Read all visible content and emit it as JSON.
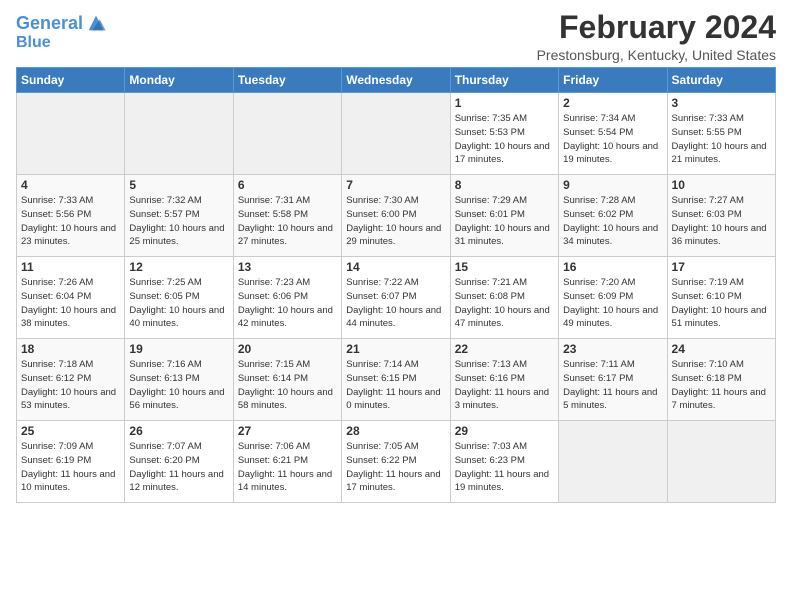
{
  "logo": {
    "line1": "General",
    "line2": "Blue"
  },
  "title": "February 2024",
  "subtitle": "Prestonsburg, Kentucky, United States",
  "days_of_week": [
    "Sunday",
    "Monday",
    "Tuesday",
    "Wednesday",
    "Thursday",
    "Friday",
    "Saturday"
  ],
  "weeks": [
    [
      {
        "num": "",
        "empty": true
      },
      {
        "num": "",
        "empty": true
      },
      {
        "num": "",
        "empty": true
      },
      {
        "num": "",
        "empty": true
      },
      {
        "num": "1",
        "sunrise": "7:35 AM",
        "sunset": "5:53 PM",
        "daylight": "10 hours and 17 minutes."
      },
      {
        "num": "2",
        "sunrise": "7:34 AM",
        "sunset": "5:54 PM",
        "daylight": "10 hours and 19 minutes."
      },
      {
        "num": "3",
        "sunrise": "7:33 AM",
        "sunset": "5:55 PM",
        "daylight": "10 hours and 21 minutes."
      }
    ],
    [
      {
        "num": "4",
        "sunrise": "7:33 AM",
        "sunset": "5:56 PM",
        "daylight": "10 hours and 23 minutes."
      },
      {
        "num": "5",
        "sunrise": "7:32 AM",
        "sunset": "5:57 PM",
        "daylight": "10 hours and 25 minutes."
      },
      {
        "num": "6",
        "sunrise": "7:31 AM",
        "sunset": "5:58 PM",
        "daylight": "10 hours and 27 minutes."
      },
      {
        "num": "7",
        "sunrise": "7:30 AM",
        "sunset": "6:00 PM",
        "daylight": "10 hours and 29 minutes."
      },
      {
        "num": "8",
        "sunrise": "7:29 AM",
        "sunset": "6:01 PM",
        "daylight": "10 hours and 31 minutes."
      },
      {
        "num": "9",
        "sunrise": "7:28 AM",
        "sunset": "6:02 PM",
        "daylight": "10 hours and 34 minutes."
      },
      {
        "num": "10",
        "sunrise": "7:27 AM",
        "sunset": "6:03 PM",
        "daylight": "10 hours and 36 minutes."
      }
    ],
    [
      {
        "num": "11",
        "sunrise": "7:26 AM",
        "sunset": "6:04 PM",
        "daylight": "10 hours and 38 minutes."
      },
      {
        "num": "12",
        "sunrise": "7:25 AM",
        "sunset": "6:05 PM",
        "daylight": "10 hours and 40 minutes."
      },
      {
        "num": "13",
        "sunrise": "7:23 AM",
        "sunset": "6:06 PM",
        "daylight": "10 hours and 42 minutes."
      },
      {
        "num": "14",
        "sunrise": "7:22 AM",
        "sunset": "6:07 PM",
        "daylight": "10 hours and 44 minutes."
      },
      {
        "num": "15",
        "sunrise": "7:21 AM",
        "sunset": "6:08 PM",
        "daylight": "10 hours and 47 minutes."
      },
      {
        "num": "16",
        "sunrise": "7:20 AM",
        "sunset": "6:09 PM",
        "daylight": "10 hours and 49 minutes."
      },
      {
        "num": "17",
        "sunrise": "7:19 AM",
        "sunset": "6:10 PM",
        "daylight": "10 hours and 51 minutes."
      }
    ],
    [
      {
        "num": "18",
        "sunrise": "7:18 AM",
        "sunset": "6:12 PM",
        "daylight": "10 hours and 53 minutes."
      },
      {
        "num": "19",
        "sunrise": "7:16 AM",
        "sunset": "6:13 PM",
        "daylight": "10 hours and 56 minutes."
      },
      {
        "num": "20",
        "sunrise": "7:15 AM",
        "sunset": "6:14 PM",
        "daylight": "10 hours and 58 minutes."
      },
      {
        "num": "21",
        "sunrise": "7:14 AM",
        "sunset": "6:15 PM",
        "daylight": "11 hours and 0 minutes."
      },
      {
        "num": "22",
        "sunrise": "7:13 AM",
        "sunset": "6:16 PM",
        "daylight": "11 hours and 3 minutes."
      },
      {
        "num": "23",
        "sunrise": "7:11 AM",
        "sunset": "6:17 PM",
        "daylight": "11 hours and 5 minutes."
      },
      {
        "num": "24",
        "sunrise": "7:10 AM",
        "sunset": "6:18 PM",
        "daylight": "11 hours and 7 minutes."
      }
    ],
    [
      {
        "num": "25",
        "sunrise": "7:09 AM",
        "sunset": "6:19 PM",
        "daylight": "11 hours and 10 minutes."
      },
      {
        "num": "26",
        "sunrise": "7:07 AM",
        "sunset": "6:20 PM",
        "daylight": "11 hours and 12 minutes."
      },
      {
        "num": "27",
        "sunrise": "7:06 AM",
        "sunset": "6:21 PM",
        "daylight": "11 hours and 14 minutes."
      },
      {
        "num": "28",
        "sunrise": "7:05 AM",
        "sunset": "6:22 PM",
        "daylight": "11 hours and 17 minutes."
      },
      {
        "num": "29",
        "sunrise": "7:03 AM",
        "sunset": "6:23 PM",
        "daylight": "11 hours and 19 minutes."
      },
      {
        "num": "",
        "empty": true
      },
      {
        "num": "",
        "empty": true
      }
    ]
  ]
}
